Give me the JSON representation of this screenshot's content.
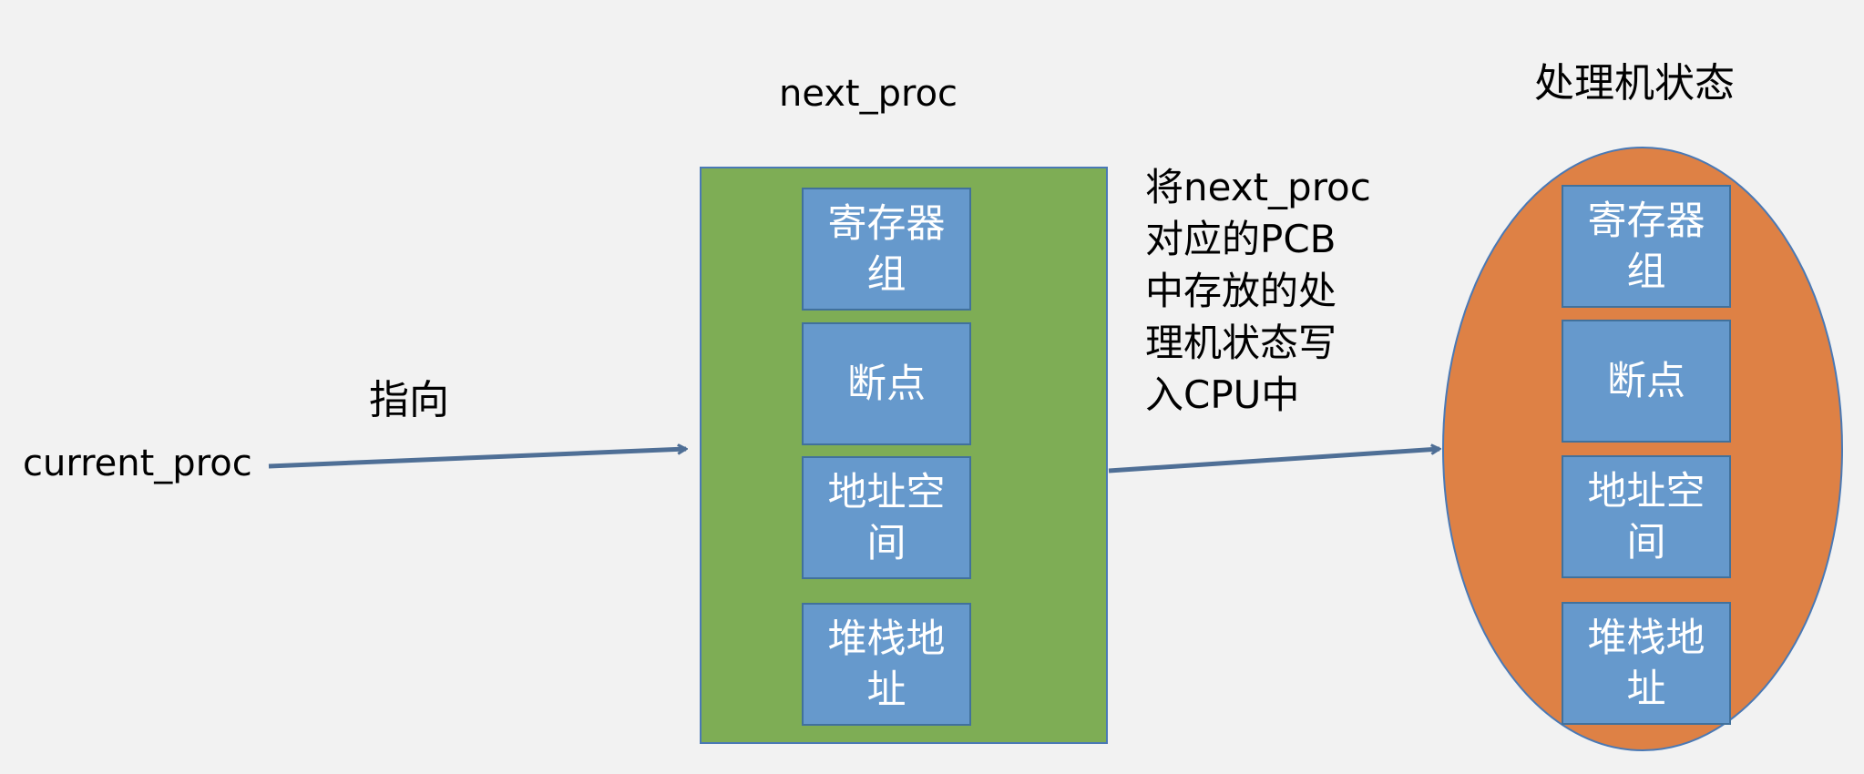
{
  "labels": {
    "next_proc": "next_proc",
    "processor_state": "处理机状态",
    "current_proc": "current_proc",
    "points_to": "指向",
    "description": [
      "将next_proc",
      "对应的PCB",
      "中存放的处",
      "理机状态写",
      "入CPU中"
    ]
  },
  "pcb_fields": [
    "寄存器组",
    "断点",
    "地址空间",
    "堆栈地址"
  ],
  "cpu_fields": [
    "寄存器组",
    "断点",
    "地址空间",
    "堆栈地址"
  ],
  "colors": {
    "background": "#f2f2f2",
    "pcb_fill": "#7ead55",
    "field_fill": "#6699cc",
    "ellipse_fill": "#de8145",
    "outline": "#4a79b5",
    "arrow": "#4f6f96"
  }
}
